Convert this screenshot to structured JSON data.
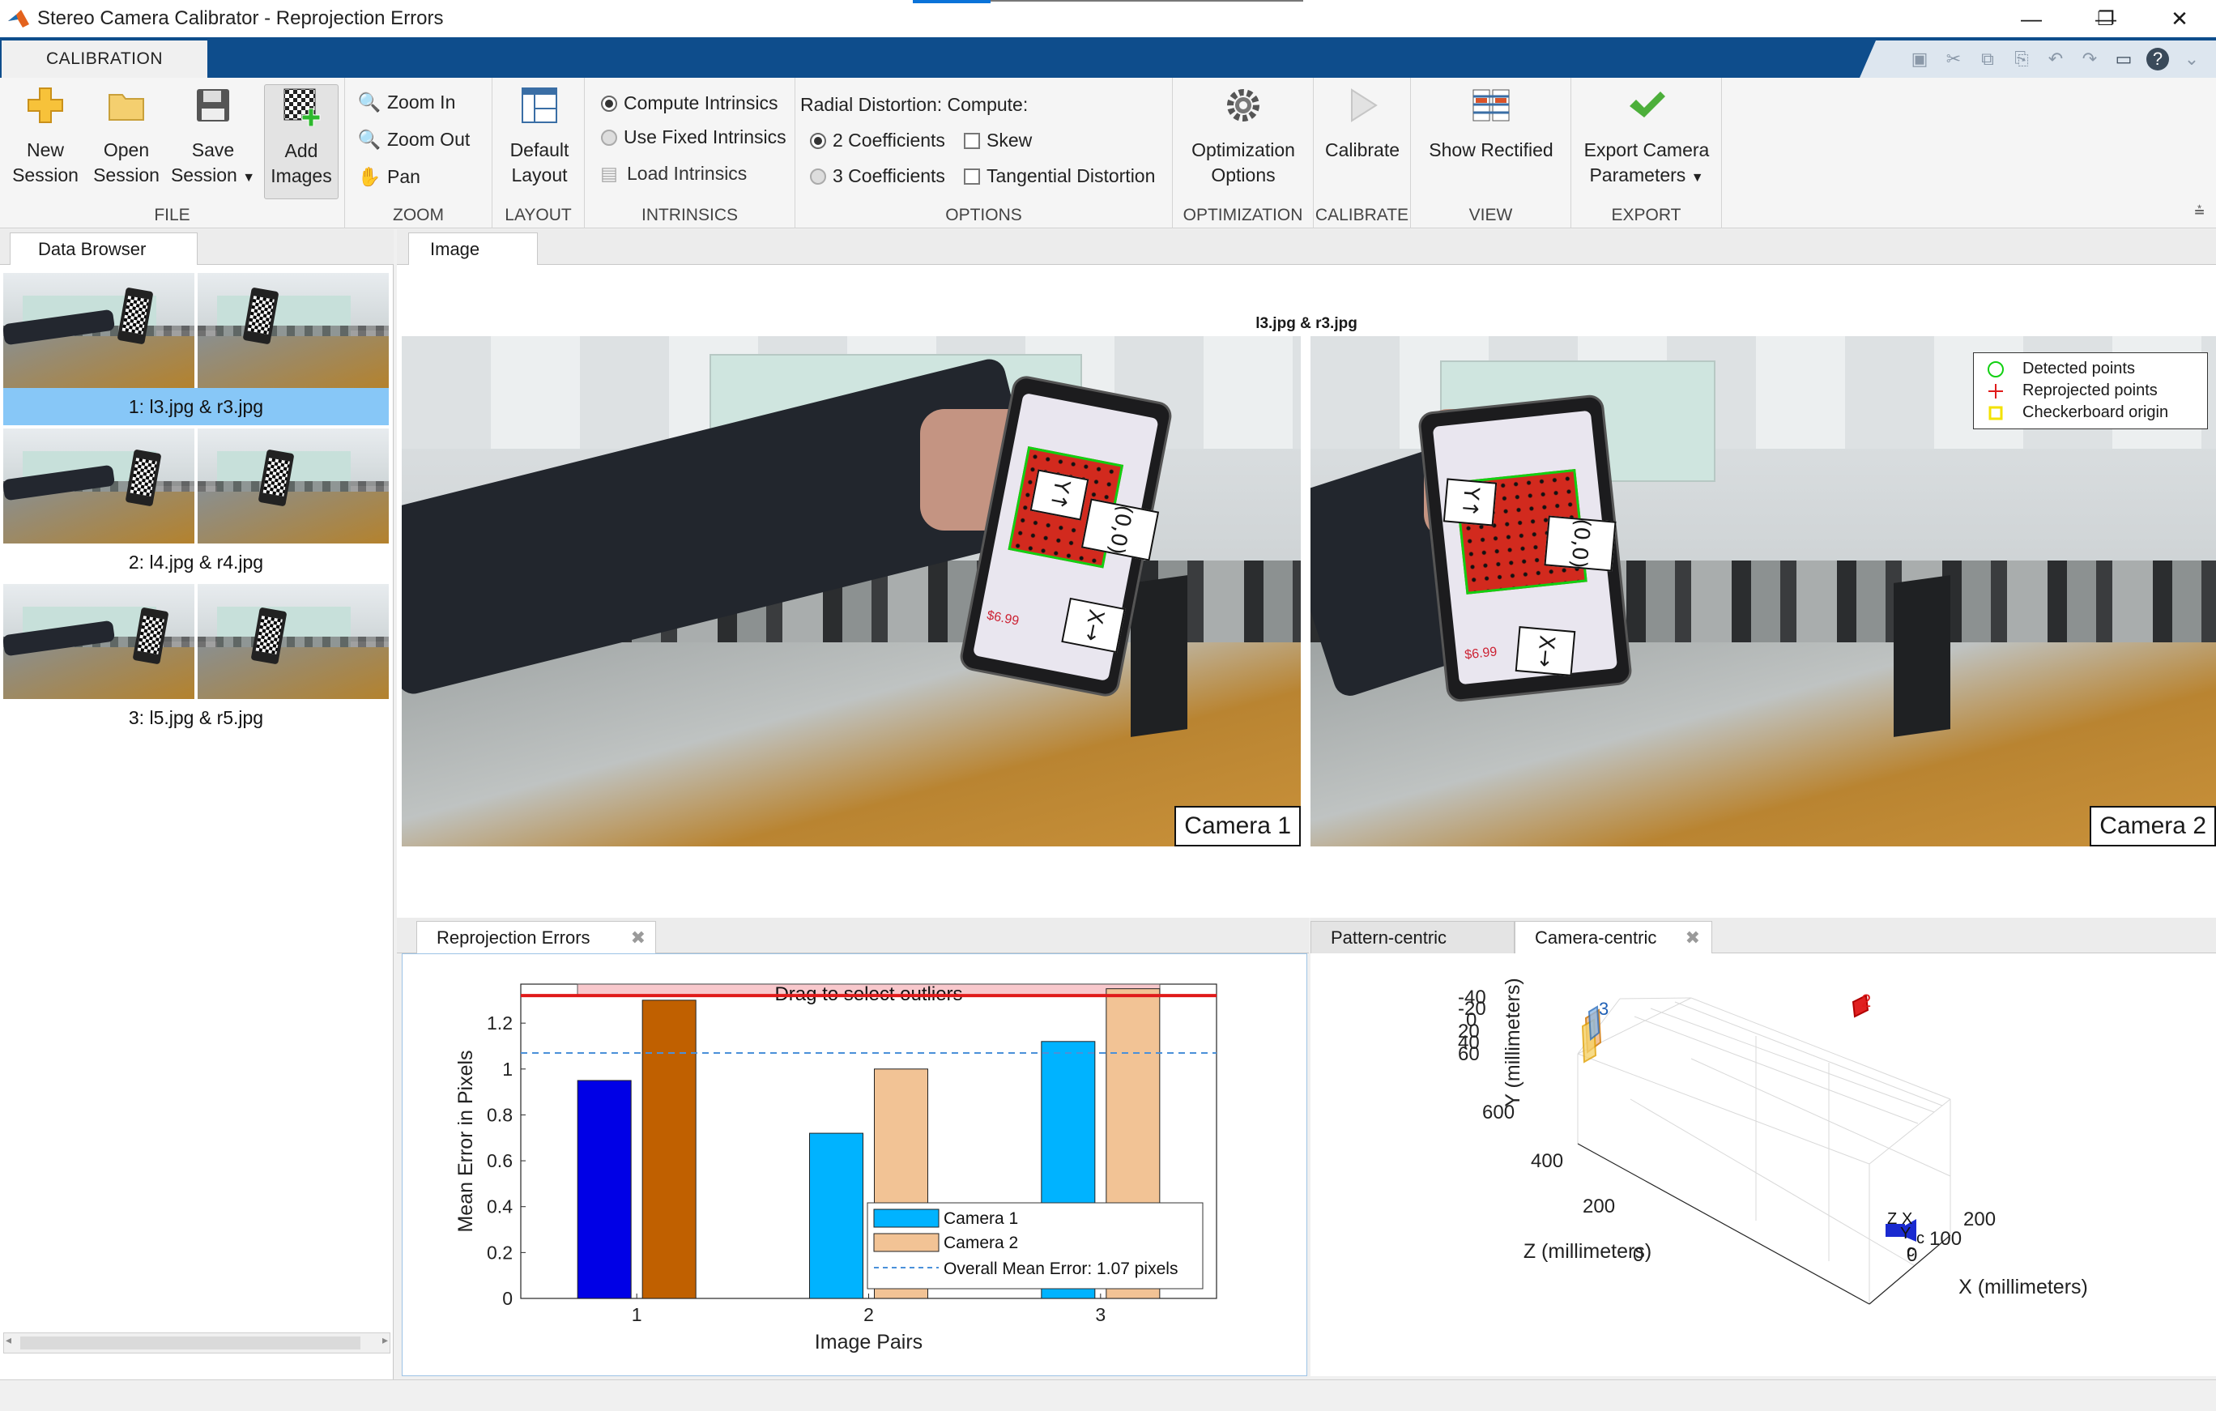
{
  "window": {
    "title": "Stereo Camera Calibrator - Reprojection Errors",
    "minimize": "—",
    "maximize": "❐",
    "close": "✕"
  },
  "ribbon": {
    "tab": "CALIBRATION",
    "file": {
      "label": "FILE",
      "new_session": [
        "New",
        "Session"
      ],
      "open_session": [
        "Open",
        "Session"
      ],
      "save_session": [
        "Save",
        "Session"
      ],
      "add_images": [
        "Add",
        "Images"
      ]
    },
    "zoom": {
      "label": "ZOOM",
      "zoom_in": "Zoom In",
      "zoom_out": "Zoom Out",
      "pan": "Pan"
    },
    "layout": {
      "label": "LAYOUT",
      "default_layout": [
        "Default",
        "Layout"
      ]
    },
    "intrinsics": {
      "label": "INTRINSICS",
      "compute": "Compute Intrinsics",
      "use_fixed": "Use Fixed Intrinsics",
      "load": "Load Intrinsics",
      "selected": "compute"
    },
    "options": {
      "label": "OPTIONS",
      "radial_heading": "Radial Distortion: Compute:",
      "two_coeff": "2 Coefficients",
      "three_coeff": "3 Coefficients",
      "skew": "Skew",
      "tangential": "Tangential Distortion",
      "selected": "2"
    },
    "optimization": {
      "label": "OPTIMIZATION",
      "options": [
        "Optimization",
        "Options"
      ]
    },
    "calibrate": {
      "label": "CALIBRATE",
      "button": "Calibrate"
    },
    "view": {
      "label": "VIEW",
      "show_rectified": "Show Rectified"
    },
    "export": {
      "label": "EXPORT",
      "button": [
        "Export Camera",
        "Parameters"
      ]
    }
  },
  "data_browser": {
    "tab": "Data Browser",
    "items": [
      {
        "label": "1: l3.jpg & r3.jpg",
        "selected": true
      },
      {
        "label": "2: l4.jpg & r4.jpg",
        "selected": false
      },
      {
        "label": "3: l5.jpg & r5.jpg",
        "selected": false
      }
    ]
  },
  "image_panel": {
    "tab": "Image",
    "title": "l3.jpg & r3.jpg",
    "camera1": "Camera 1",
    "camera2": "Camera 2",
    "pattern_labels": {
      "y": "Y↑",
      "origin": "(0,0)",
      "x": "X→"
    },
    "legend": {
      "detected": "Detected points",
      "reprojected": "Reprojected points",
      "origin": "Checkerboard origin"
    },
    "phone_price_1": "$6.99",
    "phone_price_2": "$6.99"
  },
  "reprojection": {
    "tab": "Reprojection Errors"
  },
  "extrinsics": {
    "tab_pattern": "Pattern-centric",
    "tab_camera": "Camera-centric",
    "ylabel": "Y (millimeters)",
    "zlabel": "Z (millimeters)",
    "xlabel": "X (millimeters)",
    "y_ticks": [
      "-40",
      "-20",
      "0",
      "20",
      "40",
      "60"
    ],
    "z_ticks": [
      "600",
      "400",
      "200",
      "0"
    ],
    "x_ticks": [
      "0",
      "100",
      "200"
    ],
    "pattern_ids": [
      "3",
      "2"
    ],
    "camera_labels": [
      "Z",
      "X",
      "Y",
      "c",
      "c"
    ]
  },
  "chart_data": {
    "type": "bar",
    "title": "Drag to select outliers",
    "xlabel": "Image Pairs",
    "ylabel": "Mean Error in Pixels",
    "categories": [
      "1",
      "2",
      "3"
    ],
    "series": [
      {
        "name": "Camera 1",
        "values": [
          0.95,
          0.72,
          1.12
        ],
        "colors": [
          "#0000e6",
          "#00b3ff",
          "#00b3ff"
        ]
      },
      {
        "name": "Camera 2",
        "values": [
          1.3,
          1.0,
          1.35
        ],
        "colors": [
          "#c06000",
          "#f2c395",
          "#f2c395"
        ]
      }
    ],
    "ylim": [
      0,
      1.37
    ],
    "yticks": [
      "0",
      "0.2",
      "0.4",
      "0.6",
      "0.8",
      "1",
      "1.2"
    ],
    "overall_mean_label": "Overall Mean Error: 1.07 pixels",
    "overall_mean": 1.07,
    "threshold": 1.32,
    "legend_position": "bottom-right"
  }
}
